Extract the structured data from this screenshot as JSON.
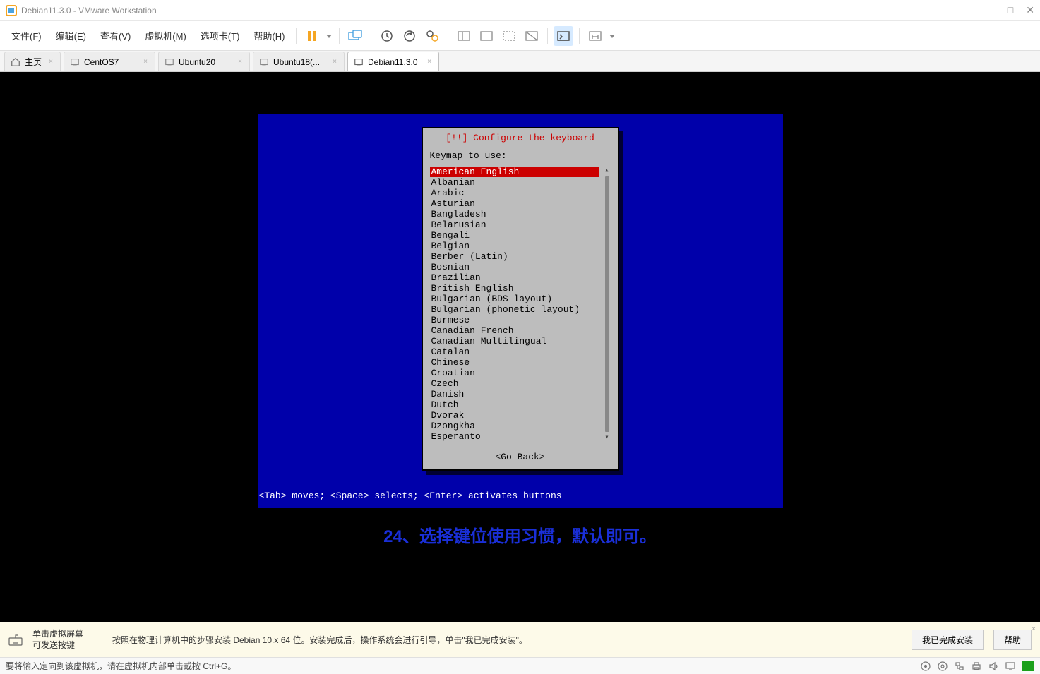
{
  "window": {
    "title": "Debian11.3.0 - VMware Workstation",
    "minimize": "—",
    "maximize": "□",
    "close": "✕"
  },
  "menu": {
    "items": [
      "文件(F)",
      "编辑(E)",
      "查看(V)",
      "虚拟机(M)",
      "选项卡(T)",
      "帮助(H)"
    ]
  },
  "tabs": {
    "home": "主页",
    "items": [
      {
        "label": "CentOS7"
      },
      {
        "label": "Ubuntu20"
      },
      {
        "label": "Ubuntu18(..."
      },
      {
        "label": "Debian11.3.0",
        "active": true
      }
    ],
    "close_x": "×"
  },
  "installer": {
    "title": "[!!] Configure the keyboard",
    "prompt": "Keymap to use:",
    "items": [
      "American English",
      "Albanian",
      "Arabic",
      "Asturian",
      "Bangladesh",
      "Belarusian",
      "Bengali",
      "Belgian",
      "Berber (Latin)",
      "Bosnian",
      "Brazilian",
      "British English",
      "Bulgarian (BDS layout)",
      "Bulgarian (phonetic layout)",
      "Burmese",
      "Canadian French",
      "Canadian Multilingual",
      "Catalan",
      "Chinese",
      "Croatian",
      "Czech",
      "Danish",
      "Dutch",
      "Dvorak",
      "Dzongkha",
      "Esperanto"
    ],
    "selected_index": 0,
    "go_back": "<Go Back>",
    "hint": "<Tab> moves; <Space> selects; <Enter> activates buttons"
  },
  "annotation": "24、选择键位使用习惯，默认即可。",
  "infobar": {
    "hint1": "单击虚拟屏幕\n可发送按键",
    "hint2": "按照在物理计算机中的步骤安装 Debian 10.x 64 位。安装完成后，操作系统会进行引导，单击\"我已完成安装\"。",
    "btn_done": "我已完成安装",
    "btn_help": "帮助",
    "close": "×"
  },
  "statusbar": {
    "text": "要将输入定向到该虚拟机，请在虚拟机内部单击或按 Ctrl+G。"
  }
}
